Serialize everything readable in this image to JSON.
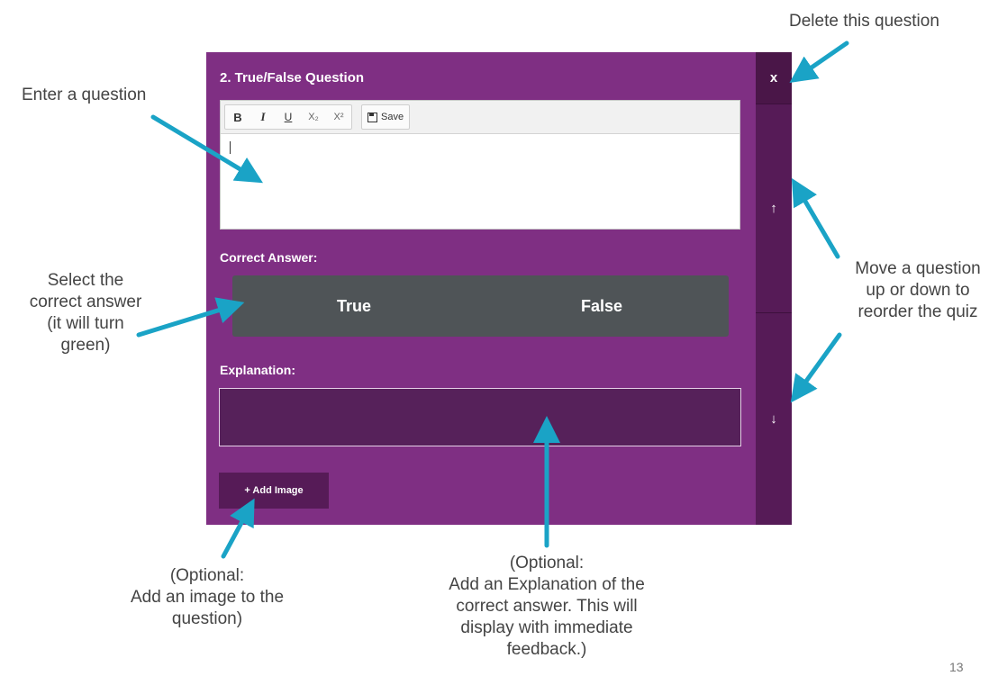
{
  "question": {
    "title": "2. True/False Question",
    "editor_text": "",
    "toolbar": {
      "bold": "B",
      "italic": "I",
      "underline": "U",
      "subscript": "X₂",
      "superscript": "X²",
      "save": "Save"
    },
    "correct_answer_label": "Correct Answer:",
    "answer_true": "True",
    "answer_false": "False",
    "explanation_label": "Explanation:",
    "add_image": "+ Add Image"
  },
  "side_controls": {
    "delete": "x",
    "up": "↑",
    "down": "↓"
  },
  "annotations": {
    "delete": "Delete this question",
    "enter_question": "Enter a question",
    "select_answer": [
      "Select the",
      "correct answer",
      "(it will turn",
      "green)"
    ],
    "move": [
      "Move a question",
      "up or down to",
      "reorder the quiz"
    ],
    "add_image": [
      "(Optional:",
      "Add an image to the",
      "question)"
    ],
    "explanation": [
      "(Optional:",
      "Add an Explanation of the",
      "correct answer. This will",
      "display with immediate",
      "feedback.)"
    ]
  },
  "page_number": "13",
  "colors": {
    "panel": "#7f2f83",
    "side": "#561b57",
    "answer_box": "#4f5457",
    "arrow": "#1aa3c6"
  }
}
